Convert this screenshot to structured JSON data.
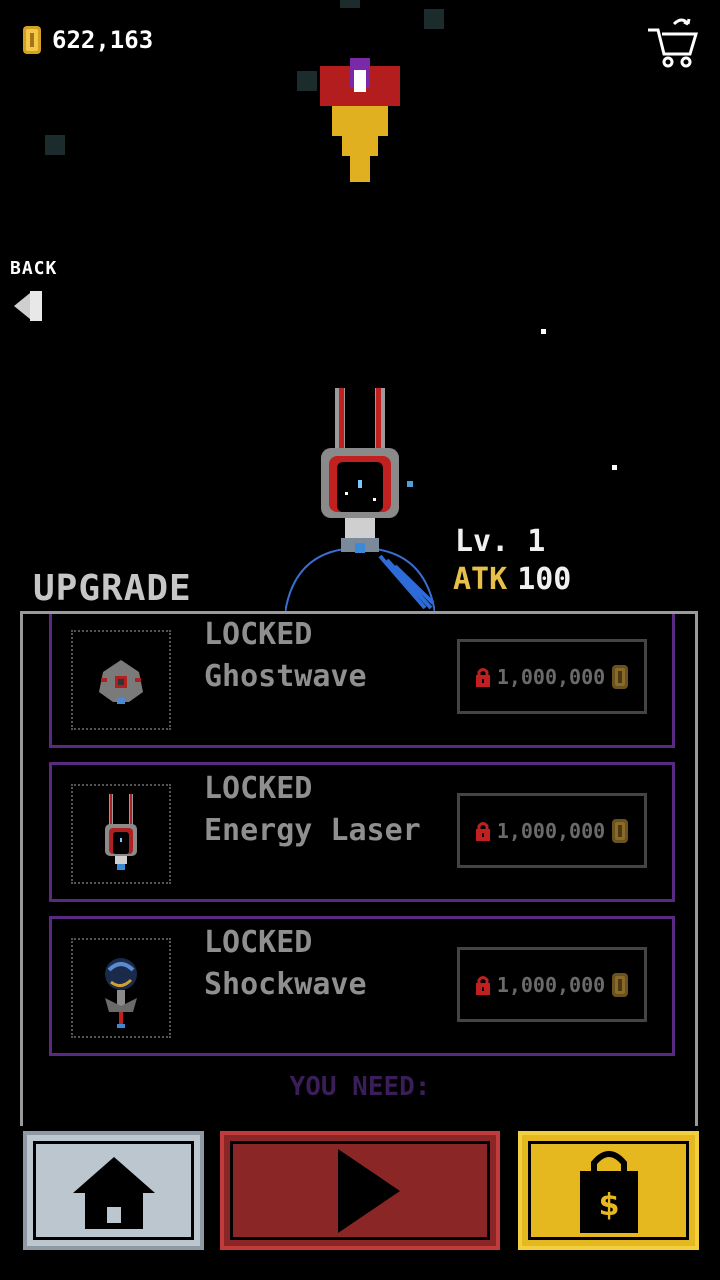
{
  "header": {
    "coins": "622,163",
    "coin_icon": "gold-coin-icon",
    "cart_icon": "shopping-cart-icon"
  },
  "back": {
    "label": "BACK",
    "icon": "back-arrow-icon"
  },
  "ship": {
    "level": "Lv. 1",
    "atk_label": "ATK",
    "atk_value": "100"
  },
  "upgrade": {
    "title": "UPGRADE",
    "items": [
      {
        "state": "LOCKED",
        "name": "Ghostwave",
        "price": "1,000,000"
      },
      {
        "state": "LOCKED",
        "name": "Energy Laser",
        "price": "1,000,000"
      },
      {
        "state": "LOCKED",
        "name": "Shockwave",
        "price": "1,000,000"
      }
    ],
    "you_need": "YOU NEED:"
  },
  "bottom_nav": {
    "home_icon": "home-icon",
    "play_icon": "play-icon",
    "shop_icon": "shopping-bag-icon"
  },
  "colors": {
    "accent_purple": "#5a2a82",
    "atk_gold": "#e6c04a",
    "play_red": "#8b2626",
    "shop_gold": "#e6b820",
    "home_gray": "#bcc6cf"
  }
}
